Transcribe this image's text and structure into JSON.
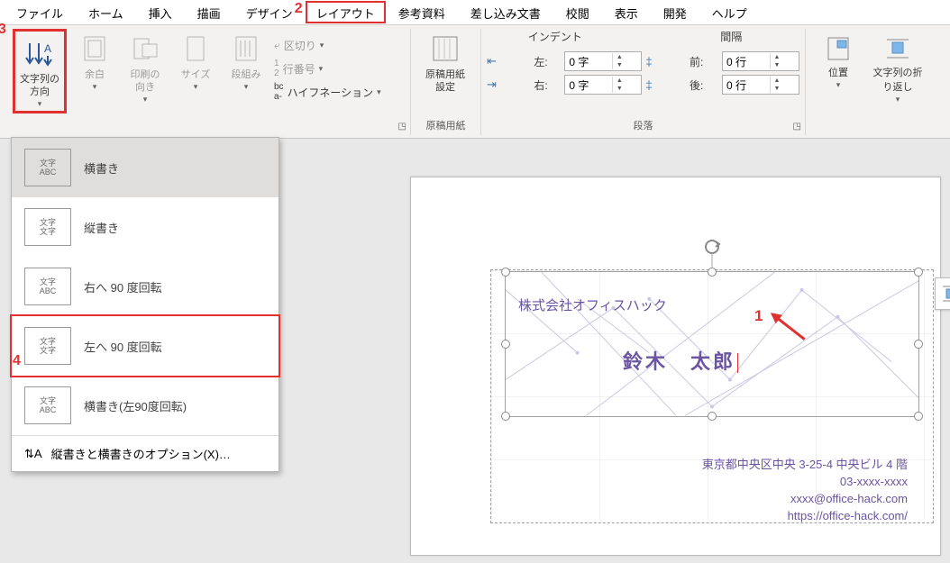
{
  "tabs": {
    "file": "ファイル",
    "home": "ホーム",
    "insert": "挿入",
    "draw": "描画",
    "design": "デザイン",
    "layout": "レイアウト",
    "references": "参考資料",
    "mailings": "差し込み文書",
    "review": "校閲",
    "view": "表示",
    "developer": "開発",
    "help": "ヘルプ"
  },
  "annotations": {
    "one": "1",
    "two": "2",
    "three": "3",
    "four": "4"
  },
  "pagesetup": {
    "text_direction_label": "文字列の\n方向",
    "margins": "余白",
    "orientation": "印刷の\n向き",
    "size": "サイズ",
    "columns": "段組み",
    "breaks": "区切り",
    "line_numbers": "行番号",
    "hyphenation": "ハイフネーション",
    "group_label": ""
  },
  "genko": {
    "button": "原稿用紙\n設定",
    "group_label": "原稿用紙"
  },
  "paragraph": {
    "indent_label": "インデント",
    "spacing_label": "間隔",
    "left_label": "左:",
    "right_label": "右:",
    "before_label": "前:",
    "after_label": "後:",
    "left_value": "0 字",
    "right_value": "0 字",
    "before_value": "0 行",
    "after_value": "0 行",
    "group_label": "段落"
  },
  "arrange": {
    "position": "位置",
    "wrap": "文字列の折\nり返し"
  },
  "text_direction_menu": {
    "horizontal": "横書き",
    "vertical": "縦書き",
    "rotate_right_90": "右へ 90 度回転",
    "rotate_left_90": "左へ 90 度回転",
    "horizontal_rotated": "横書き(左90度回転)",
    "options": "縦書きと横書きのオプション(X)…",
    "preview_h": "文字\nABC",
    "preview_v": "文字\n文字",
    "preview_r": "文字\nABC",
    "preview_l": "文字\n文字",
    "preview_hr": "文字\nABC"
  },
  "card": {
    "company": "株式会社オフィスハック",
    "name": "鈴木　太郎",
    "address": "東京都中央区中央 3-25-4  中央ビル 4 階",
    "tel": "03-xxxx-xxxx",
    "email": "xxxx@office-hack.com",
    "url": "https://office-hack.com/"
  }
}
